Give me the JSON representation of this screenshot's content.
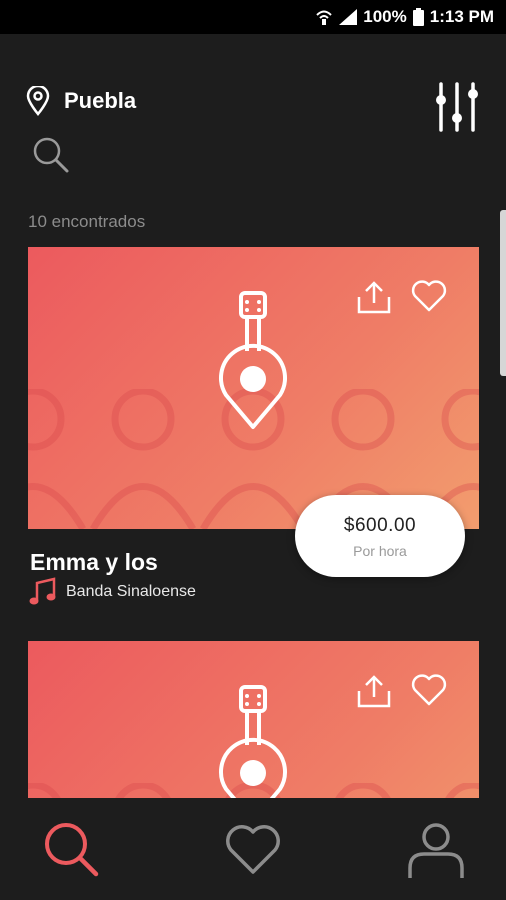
{
  "status_bar": {
    "battery": "100%",
    "time": "1:13 PM",
    "icons": [
      "wifi-icon",
      "signal-icon",
      "battery-icon"
    ]
  },
  "header": {
    "location_icon": "map-pin-icon",
    "location": "Puebla",
    "filter_icon": "sliders-icon",
    "search_icon": "search-icon"
  },
  "results": {
    "count_label": "10 encontrados"
  },
  "cards": [
    {
      "title": "Emma y los",
      "genre": "Banda Sinaloense",
      "genre_icon": "music-note-icon",
      "price": "$600.00",
      "price_unit": "Por hora",
      "image_icon": "guitar-pin-icon",
      "actions": [
        "share-icon",
        "heart-icon"
      ]
    },
    {
      "image_icon": "guitar-pin-icon",
      "actions": [
        "share-icon",
        "heart-icon"
      ]
    }
  ],
  "bottom_nav": {
    "items": [
      "search-icon",
      "heart-icon",
      "profile-icon"
    ],
    "active": "search-icon"
  },
  "colors": {
    "background": "#1d1d1d",
    "accent": "#ec5a5e",
    "card_gradient_end": "#f29d6e",
    "muted_text": "#8c8c8c"
  }
}
